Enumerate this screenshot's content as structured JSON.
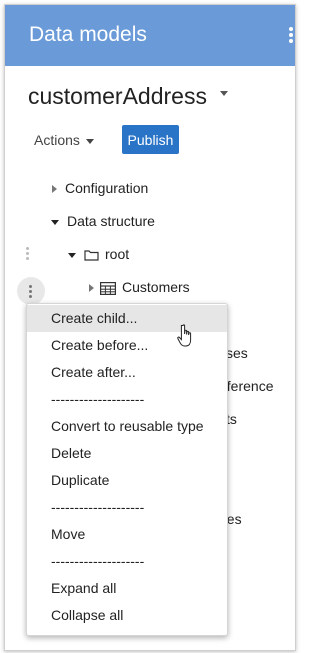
{
  "header": {
    "title": "Data models"
  },
  "model": {
    "name": "customerAddress"
  },
  "toolbar": {
    "actions_label": "Actions",
    "publish_label": "Publish"
  },
  "tree": {
    "configuration": "Configuration",
    "data_structure": "Data structure",
    "root": "root",
    "customers": "Customers"
  },
  "background_fragments": [
    "sses",
    "eference",
    "cts",
    "pes"
  ],
  "context_menu": {
    "items": [
      "Create child...",
      "Create before...",
      "Create after...",
      "--------------------",
      "Convert to reusable type",
      "Delete",
      "Duplicate",
      "--------------------",
      "Move",
      "--------------------",
      "Expand all",
      "Collapse all"
    ]
  },
  "icons": {
    "header_menu": "vertical-ellipsis-icon",
    "model_dropdown": "caret-down-icon",
    "folder": "folder-icon",
    "table": "table-icon",
    "cursor": "hand-pointer-icon"
  },
  "colors": {
    "header": "#6a9bd8",
    "publish": "#2a74c8",
    "hover": "#e6e6e6"
  }
}
